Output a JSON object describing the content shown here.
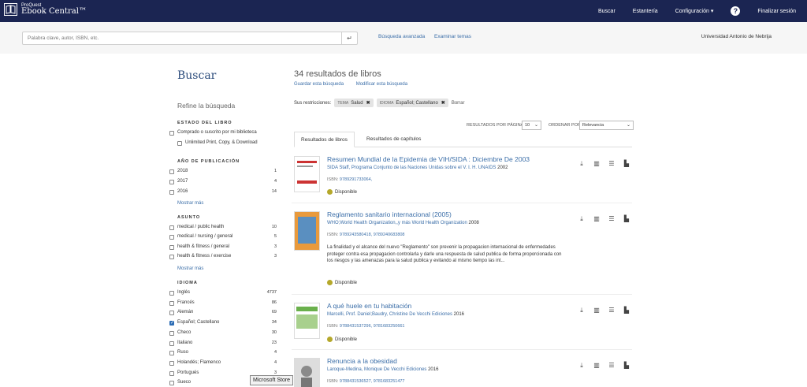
{
  "header": {
    "logo_small": "ProQuest",
    "logo_big": "Ebook Central™",
    "nav": [
      "Buscar",
      "Estantería",
      "Configuración ▾",
      "Finalizar sesión"
    ]
  },
  "search": {
    "placeholder": "Palabra clave, autor, ISBN, etc.",
    "advanced": "Búsqueda avanzada",
    "browse": "Examinar temas",
    "institution": "Universidad Antonio de Nebrija"
  },
  "sidebar": {
    "title": "Buscar",
    "refine": "Refine la búsqueda",
    "estado": {
      "heading": "ESTADO DEL LIBRO",
      "items": [
        {
          "label": "Comprado o suscrito por mi biblioteca",
          "checked": false
        },
        {
          "label": "Unlimited Print, Copy, & Download",
          "checked": false
        }
      ]
    },
    "anio": {
      "heading": "AÑO DE PUBLICACIÓN",
      "items": [
        {
          "label": "2018",
          "count": "1"
        },
        {
          "label": "2017",
          "count": "4"
        },
        {
          "label": "2016",
          "count": "14"
        }
      ],
      "more": "Mostrar más"
    },
    "asunto": {
      "heading": "ASUNTO",
      "items": [
        {
          "label": "medical / public health",
          "count": "10"
        },
        {
          "label": "medical / nursing / general",
          "count": "5"
        },
        {
          "label": "health & fitness / general",
          "count": "3"
        },
        {
          "label": "health & fitness / exercise",
          "count": "3"
        }
      ],
      "more": "Mostrar más"
    },
    "idioma": {
      "heading": "IDIOMA",
      "items": [
        {
          "label": "Inglés",
          "count": "4737",
          "checked": false
        },
        {
          "label": "Francés",
          "count": "86",
          "checked": false
        },
        {
          "label": "Alemán",
          "count": "69",
          "checked": false
        },
        {
          "label": "Español; Castellano",
          "count": "34",
          "checked": true
        },
        {
          "label": "Checo",
          "count": "30",
          "checked": false
        },
        {
          "label": "Italiano",
          "count": "23",
          "checked": false
        },
        {
          "label": "Ruso",
          "count": "4",
          "checked": false
        },
        {
          "label": "Holandés; Flamenco",
          "count": "4",
          "checked": false
        },
        {
          "label": "Portugués",
          "count": "3",
          "checked": false
        },
        {
          "label": "Sueco",
          "count": "",
          "checked": false
        }
      ]
    }
  },
  "results": {
    "count_num": "34",
    "count_text": "resultados de libros",
    "save": "Guardar esta búsqueda",
    "modify": "Modificar esta búsqueda",
    "restrictions_label": "Sus restricciones:",
    "chips": [
      {
        "key": "TEMA",
        "value": "Salud"
      },
      {
        "key": "IDIOMA",
        "value": "Español; Castellano"
      }
    ],
    "clear": "Borrar",
    "per_page_label": "RESULTADOS POR PÁGINA",
    "per_page": "10",
    "sort_label": "ORDENAR POR",
    "sort": "Relevancia",
    "tabs": [
      "Resultados de libros",
      "Resultados de capítulos"
    ],
    "isbn_label": "ISBN:",
    "available": "Disponible",
    "items": [
      {
        "title": "Resumen Mundial de la Epidemia de VIH/SIDA : Diciembre De 2003",
        "authors": "SIDA Staff, Programa Conjunto de las Naciones Unidas sobre el V. I. H.  UNAIDS",
        "year": "2002",
        "isbn": "9789291733064,",
        "desc": ""
      },
      {
        "title": "Reglamento sanitario internacional (2005)",
        "authors": "WHO;World Health Organization,,y más  World Health Organization",
        "year": "2008",
        "isbn": "9789243580418, 9789240683808",
        "desc": "La finalidad y el alcance del nuevo \"Reglamento\" son prevenir la propagacion internacional de enfermedades proteger contra esa propagacion controlarla y darle una respuesta de salud publica de forma proporcionada con los riesgos y las amenazas para la salud publica y evitando al mismo tiempo las int..."
      },
      {
        "title": "A qué huele en tu habitación",
        "authors": "Marcelli, Prof. Daniel;Baudry, Christine  De Vecchi Ediciones",
        "year": "2016",
        "isbn": "9788431537296, 9781683250661",
        "desc": ""
      },
      {
        "title": "Renuncia a la obesidad",
        "authors": "Laroque-Medina, Monique  De Vecchi Ediciones",
        "year": "2016",
        "isbn": "9788431536527, 9781683251477",
        "desc": ""
      }
    ]
  },
  "tooltip": "Microsoft Store"
}
